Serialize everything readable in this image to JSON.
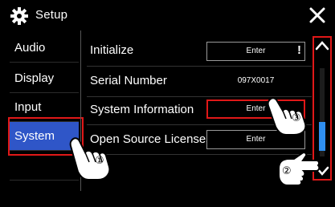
{
  "header": {
    "title": "Setup",
    "icons": [
      "gear-icon",
      "close-icon"
    ]
  },
  "sidebar": {
    "items": [
      {
        "label": "Audio"
      },
      {
        "label": "Display"
      },
      {
        "label": "Input"
      },
      {
        "label": "System",
        "active": true
      }
    ]
  },
  "main": {
    "rows": [
      {
        "label": "Initialize",
        "button": "Enter"
      },
      {
        "label": "Serial Number",
        "value": "097X0017"
      },
      {
        "label": "System Information",
        "button": "Enter"
      },
      {
        "label": "Open Source Licenses",
        "button": "Enter"
      }
    ]
  },
  "annotations": {
    "step1": "①",
    "step2": "②",
    "step3": "③"
  },
  "colors": {
    "accent": "#2f56c8",
    "highlight": "#e01818",
    "scroll_thumb": "#2f8ff0"
  }
}
